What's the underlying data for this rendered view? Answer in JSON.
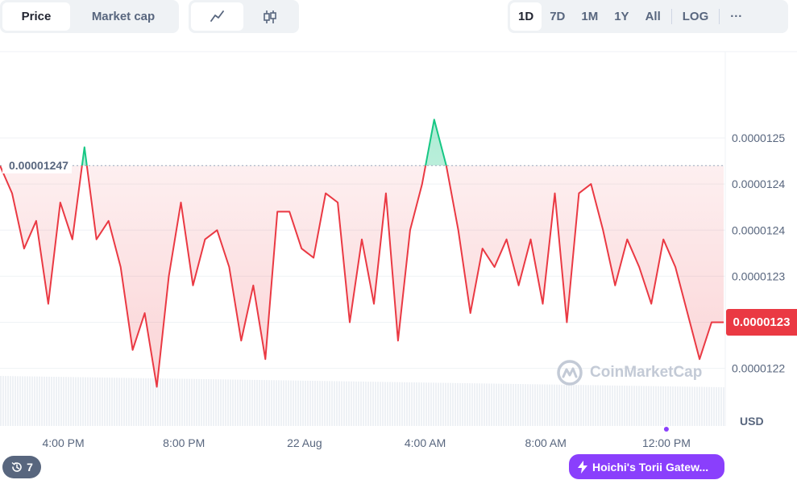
{
  "toolbar": {
    "type_tabs": [
      {
        "label": "Price",
        "active": true
      },
      {
        "label": "Market cap",
        "active": false
      }
    ],
    "chart_style": {
      "line_icon": "line-chart-icon",
      "candle_icon": "candlestick-icon",
      "active": "line"
    },
    "ranges": [
      "1D",
      "7D",
      "1M",
      "1Y",
      "All"
    ],
    "active_range": "1D",
    "log_label": "LOG",
    "more_label": "···"
  },
  "chart_data": {
    "type": "line",
    "currency_label": "USD",
    "reference_price": 1.247e-05,
    "reference_label": "0.00001247",
    "current_price_label": "0.0000123",
    "ylim": [
      1.21875e-05,
      1.25937e-05
    ],
    "ytick_values": [
      1.25e-05,
      1.245e-05,
      1.24e-05,
      1.235e-05,
      1.23e-05,
      1.225e-05
    ],
    "yticks": [
      "0.0000125",
      "0.0000124",
      "0.0000124",
      "0.0000123",
      "0.0000123",
      "0.0000122"
    ],
    "xticks": [
      "4:00 PM",
      "8:00 PM",
      "22 Aug",
      "4:00 AM",
      "8:00 AM",
      "12:00 PM"
    ],
    "x_hours": [
      0.0,
      0.4,
      0.8,
      1.2,
      1.6,
      2.0,
      2.4,
      2.8,
      3.2,
      3.6,
      4.0,
      4.4,
      4.8,
      5.2,
      5.6,
      6.0,
      6.4,
      6.8,
      7.2,
      7.6,
      8.0,
      8.4,
      8.8,
      9.2,
      9.6,
      10.0,
      10.4,
      10.8,
      11.2,
      11.6,
      12.0,
      12.4,
      12.8,
      13.2,
      13.6,
      14.0,
      14.4,
      14.8,
      15.2,
      15.6,
      16.0,
      16.4,
      16.8,
      17.2,
      17.6,
      18.0,
      18.4,
      18.8,
      19.2,
      19.6,
      20.0,
      20.4,
      20.8,
      21.2,
      21.6,
      22.0,
      22.4,
      22.8,
      23.2,
      23.6,
      24.0
    ],
    "values": [
      1.247e-05,
      1.244e-05,
      1.238e-05,
      1.241e-05,
      1.232e-05,
      1.243e-05,
      1.239e-05,
      1.249e-05,
      1.239e-05,
      1.241e-05,
      1.236e-05,
      1.227e-05,
      1.231e-05,
      1.223e-05,
      1.235e-05,
      1.243e-05,
      1.234e-05,
      1.239e-05,
      1.24e-05,
      1.236e-05,
      1.228e-05,
      1.234e-05,
      1.226e-05,
      1.242e-05,
      1.242e-05,
      1.238e-05,
      1.237e-05,
      1.244e-05,
      1.243e-05,
      1.23e-05,
      1.239e-05,
      1.232e-05,
      1.244e-05,
      1.228e-05,
      1.24e-05,
      1.245e-05,
      1.252e-05,
      1.247e-05,
      1.24e-05,
      1.231e-05,
      1.238e-05,
      1.236e-05,
      1.239e-05,
      1.234e-05,
      1.239e-05,
      1.232e-05,
      1.244e-05,
      1.23e-05,
      1.244e-05,
      1.245e-05,
      1.24e-05,
      1.234e-05,
      1.239e-05,
      1.236e-05,
      1.232e-05,
      1.239e-05,
      1.236e-05,
      1.231e-05,
      1.226e-05,
      1.23e-05,
      1.23e-05
    ],
    "colors": {
      "above": "#16c784",
      "below": "#ea3943"
    }
  },
  "watermark": "CoinMarketCap",
  "history_badge": {
    "icon": "history-icon",
    "count": "7"
  },
  "promo": {
    "icon": "lightning-icon",
    "label": "Hoichi's Torii Gatew..."
  }
}
